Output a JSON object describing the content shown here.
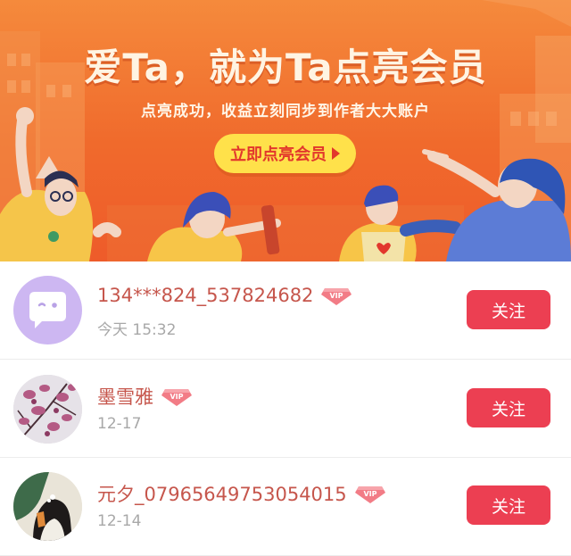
{
  "banner": {
    "title": "爱Ta，就为Ta点亮会员",
    "subtitle": "点亮成功，收益立刻同步到作者大大账户",
    "cta_label": "立即点亮会员"
  },
  "vip_badge_text": "VIP",
  "users": [
    {
      "name": "134***824_537824682",
      "time": "今天 15:32",
      "follow_label": "关注",
      "avatar": "discord-style-chat-icon"
    },
    {
      "name": "墨雪雅",
      "time": "12-17",
      "follow_label": "关注",
      "avatar": "magnolia-photo"
    },
    {
      "name": "元夕_07965649753054015",
      "time": "12-14",
      "follow_label": "关注",
      "avatar": "girl-illustration"
    }
  ],
  "colors": {
    "banner_orange": "#f06a2c",
    "cta_yellow": "#ffe14a",
    "follow_red": "#ec3f52",
    "name_red": "#c6564c"
  }
}
